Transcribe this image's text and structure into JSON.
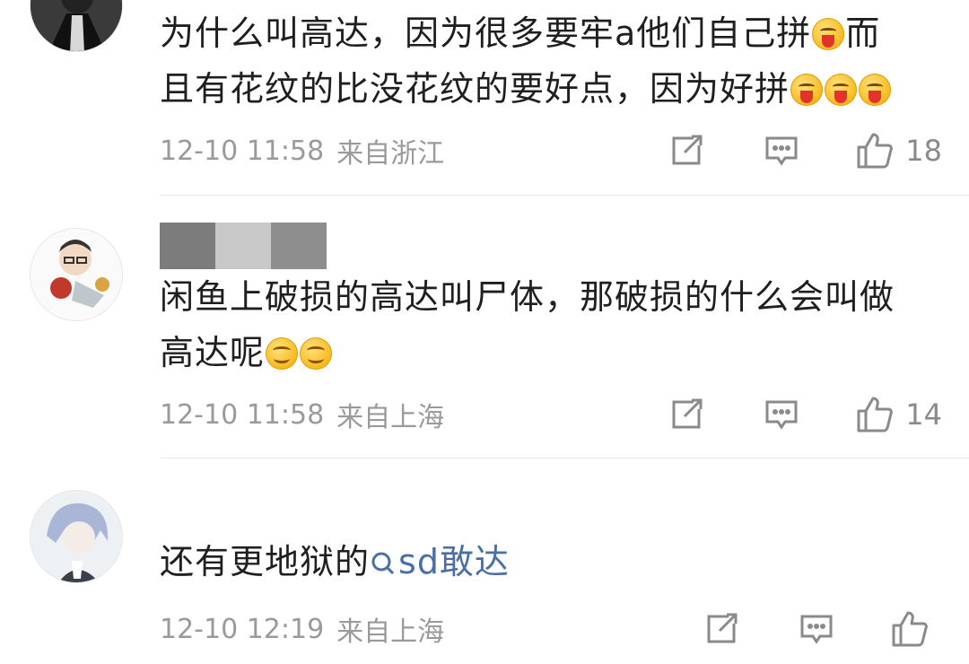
{
  "comments": [
    {
      "text_part1": "为什么叫高达，因为很多要牢a他们自己拼",
      "text_part2": "而",
      "text_line2": "且有花纹的比没花纹的要好点，因为好拼",
      "time": "12-10 11:58",
      "location": "来自浙江",
      "likes": "18",
      "emoji_names": [
        "tongue-emoji",
        "tongue-emoji",
        "tongue-emoji",
        "tongue-emoji"
      ]
    },
    {
      "text_line1": "闲鱼上破损的高达叫尸体，那破损的什么会叫做",
      "text_line2": "高达呢",
      "time": "12-10 11:58",
      "location": "来自上海",
      "likes": "14",
      "emoji_names": [
        "smile-emoji",
        "smile-emoji"
      ]
    },
    {
      "text": "还有更地狱的",
      "link_text": "sd敢达",
      "time": "12-10 12:19",
      "location": "来自上海",
      "likes": ""
    }
  ],
  "icons": {
    "share": "share-icon",
    "reply": "comment-icon",
    "like": "thumbs-up-icon",
    "search": "search-icon"
  },
  "colors": {
    "link": "#4a6fa5",
    "meta": "#9a9a9a",
    "divider": "#e8e8e8"
  }
}
